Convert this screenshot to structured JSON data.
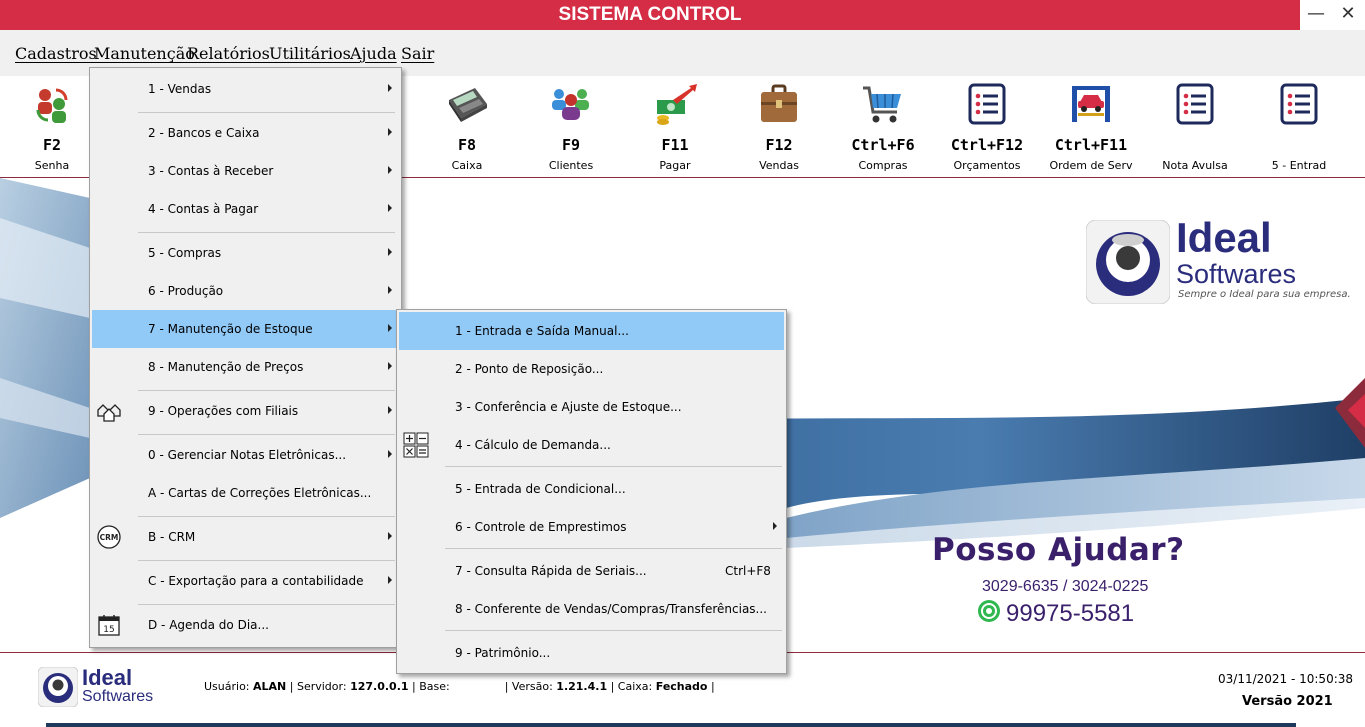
{
  "window": {
    "title": "SISTEMA CONTROL",
    "minimize_glyph": "—",
    "close_glyph": "✕"
  },
  "menubar": {
    "items": [
      {
        "label": "Cadastros"
      },
      {
        "label": "Manutenção"
      },
      {
        "label": "Relatórios"
      },
      {
        "label": "Utilitários"
      },
      {
        "label": "Ajuda"
      },
      {
        "label": "Sair"
      }
    ]
  },
  "toolbar": {
    "buttons": [
      {
        "key": "F2",
        "label": "Senha",
        "icon": "users-swap-icon"
      },
      {
        "key": "F8",
        "label": "Caixa",
        "icon": "card-terminal-icon"
      },
      {
        "key": "F9",
        "label": "Clientes",
        "icon": "clients-icon"
      },
      {
        "key": "F11",
        "label": "Pagar",
        "icon": "money-arrow-icon"
      },
      {
        "key": "F12",
        "label": "Vendas",
        "icon": "briefcase-icon"
      },
      {
        "key": "Ctrl+F6",
        "label": "Compras",
        "icon": "shopping-cart-icon"
      },
      {
        "key": "Ctrl+F12",
        "label": "Orçamentos",
        "icon": "list-icon"
      },
      {
        "key": "Ctrl+F11",
        "label": "Ordem de Serv",
        "icon": "car-lift-icon"
      },
      {
        "key": "",
        "label": "Nota Avulsa",
        "icon": "list-icon"
      },
      {
        "key": "",
        "label": "5 - Entrad",
        "icon": "list-icon"
      }
    ]
  },
  "manutencao_menu": {
    "items": [
      {
        "label": "1 - Vendas",
        "submenu": true
      },
      {
        "label": "2 - Bancos e Caixa",
        "submenu": true
      },
      {
        "label": "3 - Contas à Receber",
        "submenu": true
      },
      {
        "label": "4 - Contas à Pagar",
        "submenu": true
      },
      {
        "label": "5 - Compras",
        "submenu": true
      },
      {
        "label": "6 - Produção",
        "submenu": true
      },
      {
        "label": "7 - Manutenção de Estoque",
        "submenu": true,
        "highlighted": true
      },
      {
        "label": "8 - Manutenção de Preços",
        "submenu": true
      },
      {
        "label": "9 - Operações com Filiais",
        "submenu": true,
        "icon": "branches-icon"
      },
      {
        "label": "0 - Gerenciar Notas Eletrônicas...",
        "submenu": true
      },
      {
        "label": "A - Cartas de Correções Eletrônicas...",
        "submenu": false
      },
      {
        "label": "B - CRM",
        "submenu": true,
        "icon": "crm-icon",
        "icon_text": "CRM"
      },
      {
        "label": "C - Exportação para a contabilidade",
        "submenu": true
      },
      {
        "label": "D - Agenda do Dia...",
        "submenu": false,
        "icon": "calendar-icon",
        "icon_text": "15"
      }
    ]
  },
  "estoque_submenu": {
    "items": [
      {
        "label": "1 - Entrada e Saída Manual...",
        "highlighted": true
      },
      {
        "label": "2 - Ponto de Reposição..."
      },
      {
        "label": "3 - Conferência e Ajuste de Estoque..."
      },
      {
        "label": "4 - Cálculo de Demanda...",
        "icon": "calculator-icon"
      },
      {
        "label": "5 - Entrada de Condicional..."
      },
      {
        "label": "6 - Controle de Emprestimos",
        "submenu": true
      },
      {
        "label": "7 - Consulta Rápida de Seriais...",
        "shortcut": "Ctrl+F8"
      },
      {
        "label": "8 - Conferente de Vendas/Compras/Transferências..."
      },
      {
        "label": "9 - Patrimônio..."
      }
    ]
  },
  "branding": {
    "name": "Ideal",
    "sub": "Softwares",
    "tagline": "Sempre o Ideal para sua empresa."
  },
  "contact": {
    "title": "Posso Ajudar?",
    "phones": "3029-6635 / 3024-0225",
    "whatsapp": "99975-5581"
  },
  "statusbar": {
    "brand": "Ideal",
    "brand_sub": "Softwares",
    "user_label": "Usuário: ",
    "user": "ALAN",
    "server_label": " | Servidor: ",
    "server": "127.0.0.1",
    "base_label": " | Base: ",
    "base": "",
    "version_label": " | Versão: ",
    "version": "1.21.4.1",
    "caixa_label": " | Caixa: ",
    "caixa": "Fechado",
    "caixa_end": " |",
    "datetime": "03/11/2021 - 10:50:38",
    "version_year": "Versão 2021"
  },
  "colors": {
    "titlebar": "#d42d45",
    "menu_highlight": "#91c9f7",
    "brand_navy": "#2a2c7c",
    "contact_purple": "#3a1f6b"
  }
}
